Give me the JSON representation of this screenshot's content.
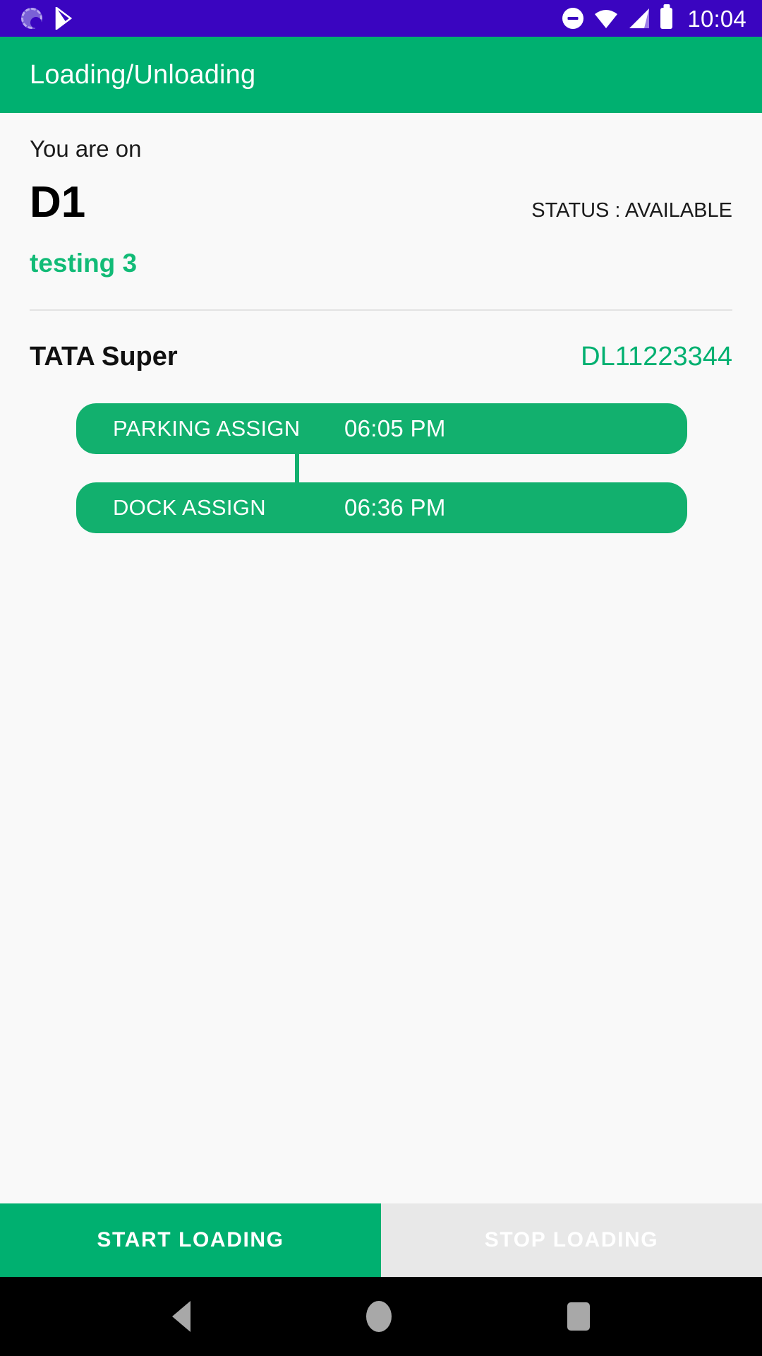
{
  "status_bar": {
    "time": "10:04",
    "icons_left": [
      "sync-icon",
      "play-store-icon"
    ],
    "icons_right": [
      "do-not-disturb-icon",
      "wifi-icon",
      "cellular-signal-icon",
      "battery-icon"
    ],
    "background_color": "#3a05c0"
  },
  "app_bar": {
    "title": "Loading/Unloading",
    "background_color": "#00b070",
    "text_color": "#ffffff"
  },
  "main": {
    "prompt_label": "You are on",
    "dock_name": "D1",
    "dock_status": "STATUS : AVAILABLE",
    "site_name": "testing 3",
    "site_name_color": "#12bb77",
    "vehicle": {
      "model": "TATA Super",
      "plate_number": "DL11223344",
      "plate_color": "#00b070"
    },
    "timeline": [
      {
        "label": "PARKING ASSIGN",
        "time": "06:05 PM"
      },
      {
        "label": "DOCK ASSIGN",
        "time": "06:36 PM"
      }
    ]
  },
  "actions": {
    "start_label": "START LOADING",
    "stop_label": "STOP LOADING",
    "start_color": "#00b070",
    "stop_color": "#e8e8e8"
  },
  "nav_bar": {
    "back": "back-icon",
    "home": "home-icon",
    "recents": "recents-icon",
    "background_color": "#000000"
  }
}
